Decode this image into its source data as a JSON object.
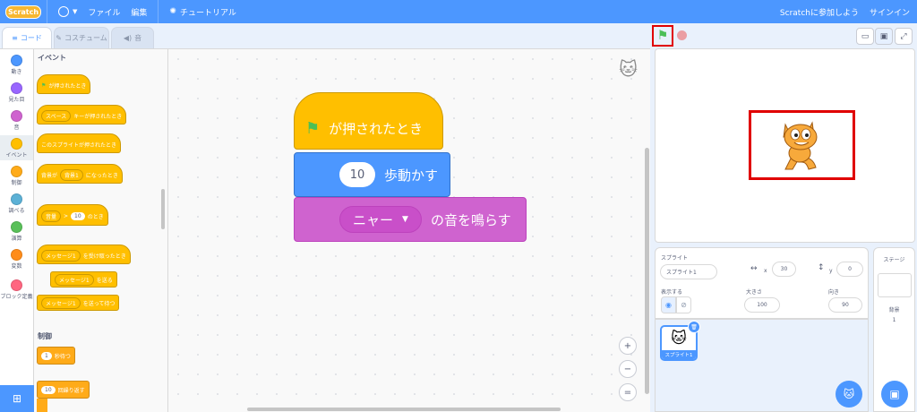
{
  "menu": {
    "logo": "Scratch",
    "file": "ファイル",
    "edit": "編集",
    "tutorials": "チュートリアル",
    "join": "Scratchに参加しよう",
    "signin": "サインイン"
  },
  "tabs": {
    "code": "コード",
    "costumes": "コスチューム",
    "sounds": "音"
  },
  "categories": [
    {
      "label": "動き",
      "color": "#4c97ff"
    },
    {
      "label": "見た目",
      "color": "#9966ff"
    },
    {
      "label": "音",
      "color": "#cf63cf"
    },
    {
      "label": "イベント",
      "color": "#ffbf00"
    },
    {
      "label": "制御",
      "color": "#ffab19"
    },
    {
      "label": "調べる",
      "color": "#5cb1d6"
    },
    {
      "label": "演算",
      "color": "#59c059"
    },
    {
      "label": "変数",
      "color": "#ff8c1a"
    },
    {
      "label": "ブロック定義",
      "color": "#ff6680"
    }
  ],
  "palette": {
    "events_heading": "イベント",
    "control_heading": "制御",
    "when_flag": "が押されたとき",
    "key_drop": "スペース",
    "key_text": "キーが押されたとき",
    "sprite_clicked": "このスプライトが押されたとき",
    "backdrop_pre": "背景が",
    "backdrop_drop": "背景1",
    "backdrop_post": "になったとき",
    "loud_drop": "音量",
    "loud_op": ">",
    "loud_val": "10",
    "loud_post": "のとき",
    "receive_drop": "メッセージ1",
    "receive_text": "を受け取ったとき",
    "broadcast_drop": "メッセージ1",
    "broadcast_text": "を送る",
    "broadcast_wait_drop": "メッセージ1",
    "broadcast_wait_text": "を送って待つ",
    "wait_val": "1",
    "wait_text": "秒待つ",
    "repeat_val": "10",
    "repeat_text": "回繰り返す"
  },
  "script": {
    "hat": "が押されたとき",
    "move_val": "10",
    "move_text": "歩動かす",
    "sound_drop": "ニャー",
    "sound_text": "の音を鳴らす"
  },
  "zoom": {
    "in": "+",
    "out": "−",
    "reset": "="
  },
  "sprite_info": {
    "sprite_label": "スプライト",
    "sprite_name": "スプライト1",
    "x_label": "x",
    "x_value": "30",
    "y_label": "y",
    "y_value": "0",
    "show_label": "表示する",
    "size_label": "大きさ",
    "size_value": "100",
    "direction_label": "向き",
    "direction_value": "90"
  },
  "sprite_list": [
    {
      "name": "スプライト1"
    }
  ],
  "stage_panel": {
    "title": "ステージ",
    "backdrop_label": "背景",
    "backdrop_count": "1"
  },
  "colors": {
    "accent": "#4c97ff",
    "highlight": "#e00000",
    "events": "#ffbf00",
    "motion": "#4c97ff",
    "sound": "#cf63cf"
  }
}
